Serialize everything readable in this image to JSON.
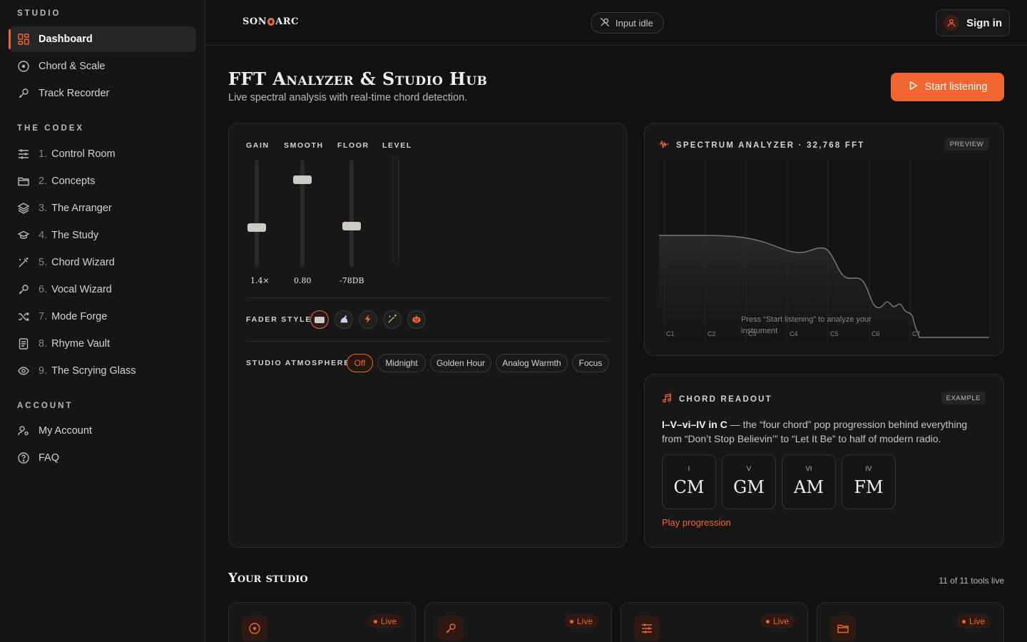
{
  "sidebar": {
    "studio_title": "STUDIO",
    "studio_items": [
      {
        "label": "Dashboard",
        "icon": "dashboard-icon",
        "active": true
      },
      {
        "label": "Chord & Scale",
        "icon": "circle-dot-icon"
      },
      {
        "label": "Track Recorder",
        "icon": "microphone-icon"
      }
    ],
    "codex_title": "THE CODEX",
    "codex_items": [
      {
        "num": "1.",
        "label": "Control Room",
        "icon": "sliders-icon"
      },
      {
        "num": "2.",
        "label": "Concepts",
        "icon": "folder-icon"
      },
      {
        "num": "3.",
        "label": "The Arranger",
        "icon": "layers-icon"
      },
      {
        "num": "4.",
        "label": "The Study",
        "icon": "graduation-cap-icon"
      },
      {
        "num": "5.",
        "label": "Chord Wizard",
        "icon": "magic-wand-icon"
      },
      {
        "num": "6.",
        "label": "Vocal Wizard",
        "icon": "microphone-icon"
      },
      {
        "num": "7.",
        "label": "Mode Forge",
        "icon": "shuffle-icon"
      },
      {
        "num": "8.",
        "label": "Rhyme Vault",
        "icon": "notebook-icon"
      },
      {
        "num": "9.",
        "label": "The Scrying Glass",
        "icon": "eye-icon"
      }
    ],
    "account_title": "ACCOUNT",
    "account_items": [
      {
        "label": "My Account",
        "icon": "user-settings-icon"
      },
      {
        "label": "FAQ",
        "icon": "help-circle-icon"
      }
    ]
  },
  "topbar": {
    "logo_left": "SON",
    "logo_right": "ARC",
    "input_status": "Input idle",
    "sign_in": "Sign in"
  },
  "header": {
    "title": "FFT Analyzer & Studio Hub",
    "subtitle": "Live spectral analysis with real-time chord detection.",
    "start_button": "Start listening"
  },
  "controls": {
    "faders": [
      {
        "label": "GAIN",
        "value": "1.4×",
        "level": 0.35
      },
      {
        "label": "SMOOTH",
        "value": "0.80",
        "level": 0.8
      },
      {
        "label": "FLOOR",
        "value": "-78DB",
        "level": 0.36
      },
      {
        "label": "LEVEL",
        "value": "",
        "level": 0
      }
    ],
    "fader_style_label": "FADER STYLE",
    "fader_styles": [
      "rectangle-style-icon",
      "unicorn-style-icon",
      "lightning-style-icon",
      "magic-wand-style-icon",
      "pumpkin-style-icon"
    ],
    "fader_style_selected": 0,
    "atmosphere_label": "STUDIO ATMOSPHERE",
    "atmospheres": [
      "Off",
      "Midnight",
      "Golden Hour",
      "Analog Warmth",
      "Focus"
    ],
    "atmosphere_selected": "Off"
  },
  "spectrum": {
    "title": "SPECTRUM ANALYZER · 32,768 FFT",
    "badge": "PREVIEW",
    "note_labels": [
      "C1",
      "C2",
      "C3",
      "C4",
      "C5",
      "C6",
      "C7"
    ],
    "hint": "Press “Start listening” to analyze your instrument",
    "accent": "#f06530"
  },
  "chord": {
    "title": "CHORD READOUT",
    "badge": "EXAMPLE",
    "desc_bold": "I–V–vi–IV in C",
    "desc_rest": " — the “four chord” pop progression behind everything from “Don’t Stop Believin’” to “Let It Be” to half of modern radio.",
    "chords": [
      {
        "roman": "I",
        "name": "CM"
      },
      {
        "roman": "V",
        "name": "GM"
      },
      {
        "roman": "VI",
        "name": "AM"
      },
      {
        "roman": "IV",
        "name": "FM"
      }
    ],
    "play_label": "Play progression"
  },
  "studio": {
    "title": "Your studio",
    "count": "11 of 11 tools live",
    "tools": [
      {
        "icon": "circle-dot-icon",
        "status": "Live"
      },
      {
        "icon": "microphone-icon",
        "status": "Live"
      },
      {
        "icon": "sliders-icon",
        "status": "Live"
      },
      {
        "icon": "folder-icon",
        "status": "Live"
      }
    ]
  },
  "colors": {
    "accent": "#f06530",
    "background": "#111111",
    "panel": "#171717"
  }
}
